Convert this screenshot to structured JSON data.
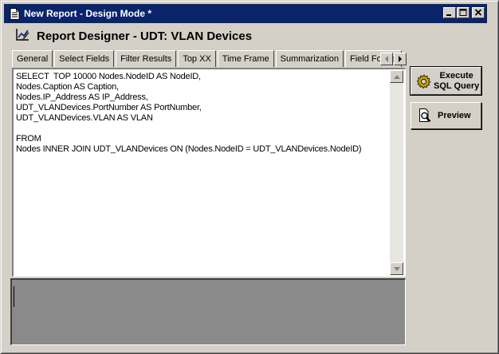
{
  "window": {
    "title": "New Report - Design Mode *"
  },
  "designer": {
    "title": "Report Designer - UDT: VLAN Devices"
  },
  "tabs": [
    {
      "label": "General"
    },
    {
      "label": "Select Fields"
    },
    {
      "label": "Filter Results"
    },
    {
      "label": "Top XX"
    },
    {
      "label": "Time Frame"
    },
    {
      "label": "Summarization"
    },
    {
      "label": "Field Forma"
    }
  ],
  "editor": {
    "sql_text": "SELECT  TOP 10000 Nodes.NodeID AS NodeID,\nNodes.Caption AS Caption,\nNodes.IP_Address AS IP_Address,\nUDT_VLANDevices.PortNumber AS PortNumber,\nUDT_VLANDevices.VLAN AS VLAN\n\nFROM\nNodes INNER JOIN UDT_VLANDevices ON (Nodes.NodeID = UDT_VLANDevices.NodeID)"
  },
  "buttons": {
    "execute_line1": "Execute",
    "execute_line2": "SQL Query",
    "preview": "Preview"
  },
  "icons": {
    "title": "document-icon",
    "designer": "report-designer-icon",
    "execute": "gear-icon",
    "preview": "magnifier-document-icon"
  },
  "colors": {
    "titlebar": "#0a246a",
    "face": "#d4d0c8",
    "output_bg": "#8a8a8a"
  }
}
